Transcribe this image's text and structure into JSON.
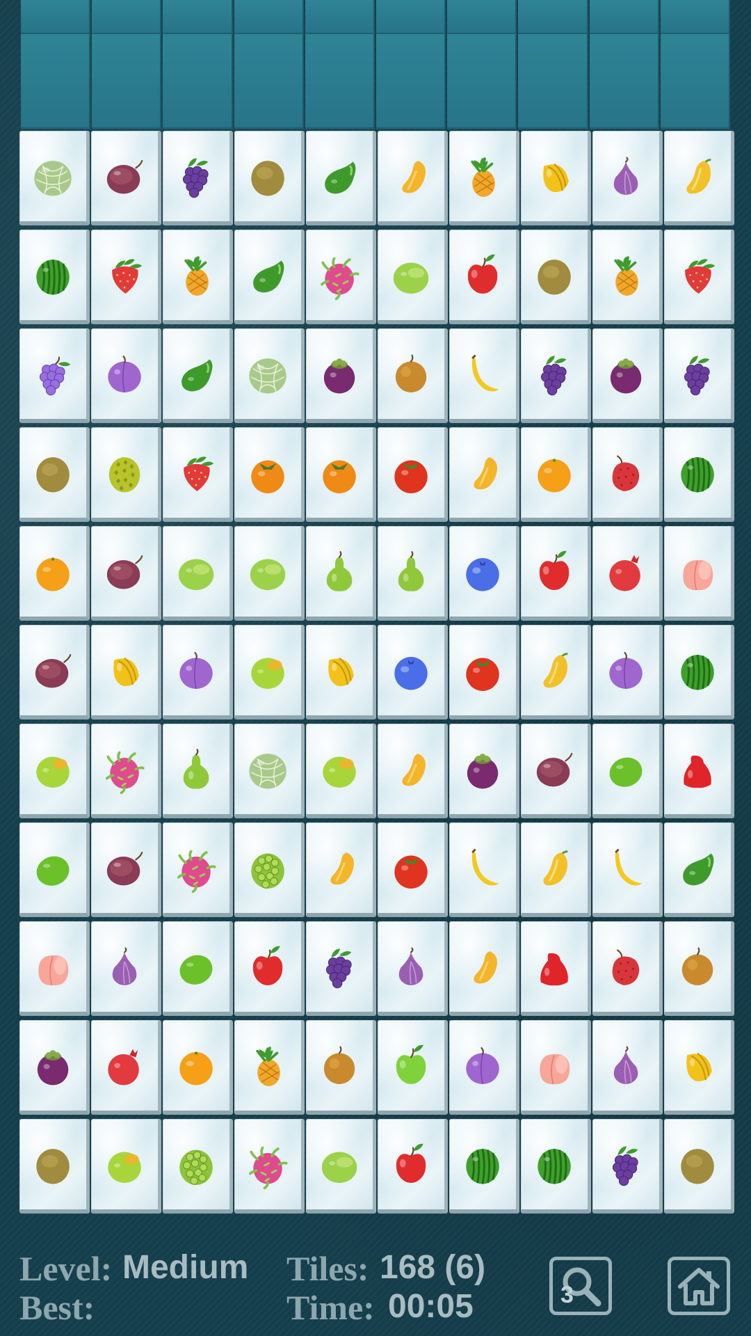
{
  "status": {
    "level_label": "Level:",
    "level_value": "Medium",
    "best_label": "Best:",
    "best_value": "",
    "tiles_label": "Tiles:",
    "tiles_value": "168 (6)",
    "time_label": "Time:",
    "time_value": "00:05"
  },
  "hint": {
    "icon": "magnifier-icon",
    "count": "3"
  },
  "home": {
    "icon": "home-icon"
  },
  "board": {
    "rows": 11,
    "cols": 10,
    "tiles": [
      [
        "melon",
        "passionfruit",
        "blackberry",
        "kiwi",
        "avocado",
        "mango",
        "pineapple",
        "starfruit",
        "fig",
        "papaya"
      ],
      [
        "watermelon",
        "strawberry",
        "pineapple",
        "avocado",
        "dragonfruit",
        "greenmango",
        "apple",
        "kiwi",
        "pineapple",
        "strawberry"
      ],
      [
        "grapes",
        "plum",
        "avocado",
        "melon",
        "mangosteen",
        "asianpear",
        "banana",
        "blackberry",
        "mangosteen",
        "blackberry"
      ],
      [
        "kiwi",
        "durian",
        "strawberry",
        "persimmon",
        "persimmon",
        "tomato",
        "mango",
        "orange",
        "lychee",
        "watermelon"
      ],
      [
        "orange",
        "passionfruit",
        "greenmango",
        "greenmango",
        "pear",
        "pear",
        "blueberry",
        "apple",
        "pomegranate",
        "peach"
      ],
      [
        "passionfruit",
        "starfruit",
        "plum",
        "apricotmango",
        "starfruit",
        "blueberry",
        "tomato",
        "papaya",
        "plum",
        "watermelon"
      ],
      [
        "apricotmango",
        "dragonfruit",
        "pear",
        "melon",
        "apricotmango",
        "mango",
        "mangosteen",
        "passionfruit",
        "lime",
        "roseapple"
      ],
      [
        "lime",
        "passionfruit",
        "dragonfruit",
        "custardapple",
        "mango",
        "tomato",
        "banana",
        "papaya",
        "banana",
        "avocado"
      ],
      [
        "peach",
        "fig",
        "lime",
        "apple",
        "blackberry",
        "fig",
        "mango",
        "roseapple",
        "lychee",
        "asianpear"
      ],
      [
        "mangosteen",
        "pomegranate",
        "orange",
        "pineapple",
        "asianpear",
        "greenapple",
        "plum",
        "peach",
        "fig",
        "starfruit"
      ],
      [
        "kiwi",
        "apricotmango",
        "custardapple",
        "dragonfruit",
        "greenmango",
        "apple",
        "watermelon",
        "watermelon",
        "blackberry",
        "kiwi"
      ]
    ]
  },
  "colors": {
    "background": "#153f4d",
    "back_tile": "#2a7a8c",
    "tile_face": "#e3f0f4",
    "label": "#8ea6ae",
    "value": "#a9bcc2"
  }
}
